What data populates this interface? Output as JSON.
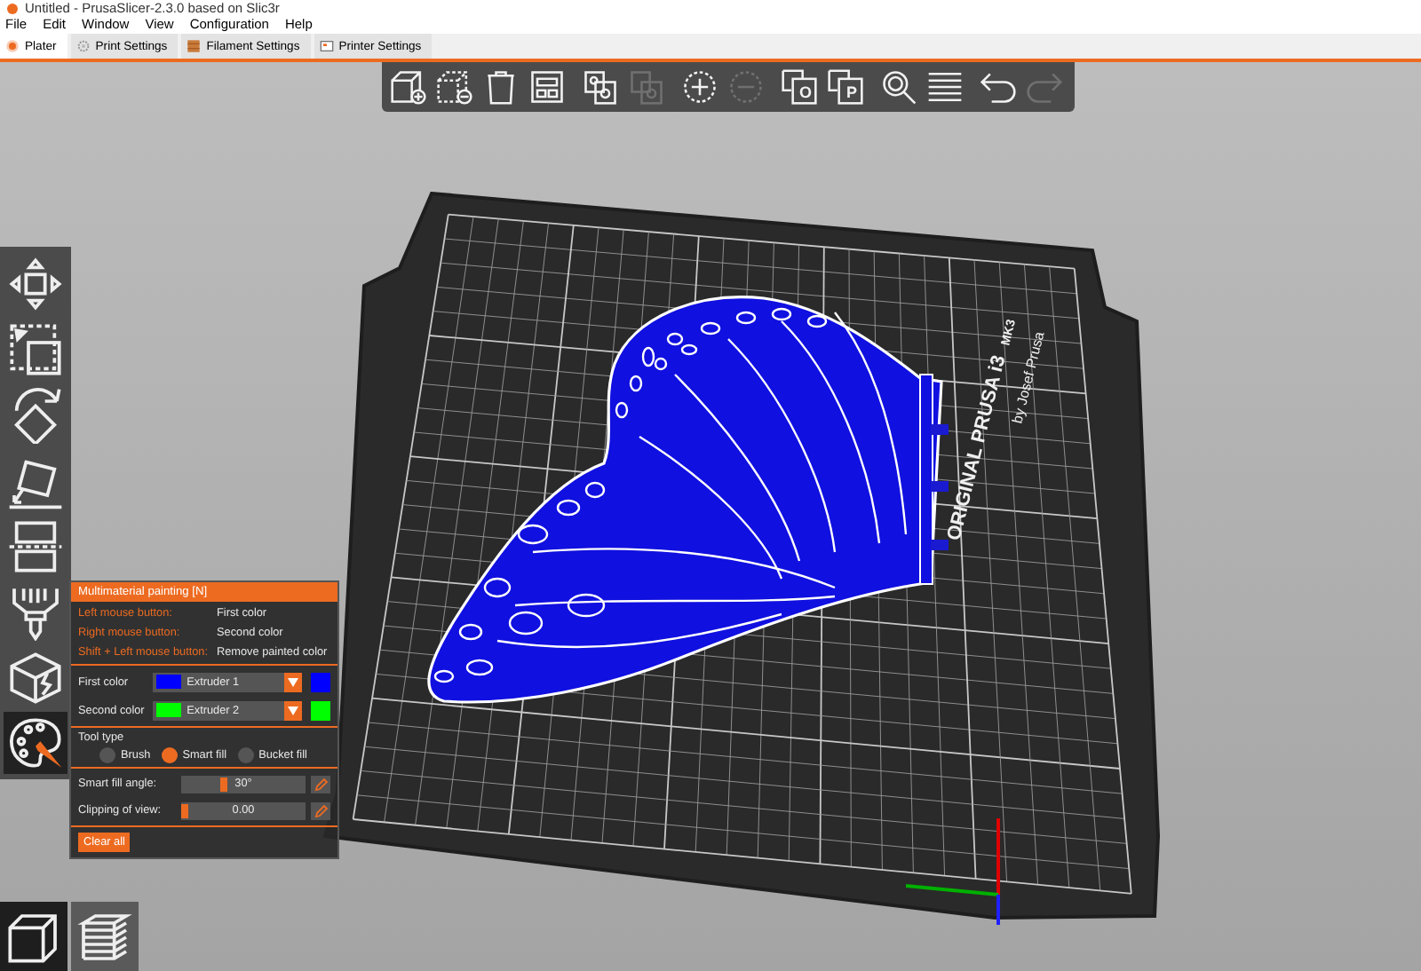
{
  "window": {
    "title": "Untitled - PrusaSlicer-2.3.0 based on Slic3r"
  },
  "menu": [
    "File",
    "Edit",
    "Window",
    "View",
    "Configuration",
    "Help"
  ],
  "tabs": [
    {
      "label": "Plater",
      "kind": "plater",
      "selected": true
    },
    {
      "label": "Print Settings",
      "kind": "print",
      "selected": false
    },
    {
      "label": "Filament Settings",
      "kind": "filament",
      "selected": false
    },
    {
      "label": "Printer Settings",
      "kind": "printer",
      "selected": false
    }
  ],
  "toolbar": [
    {
      "kind": "add",
      "disabled": false
    },
    {
      "kind": "delete",
      "disabled": false
    },
    {
      "kind": "delete_all",
      "disabled": false
    },
    {
      "kind": "arrange",
      "disabled": false
    },
    {
      "kind": "copy",
      "disabled": false
    },
    {
      "kind": "paste",
      "disabled": true
    },
    {
      "kind": "add_instance",
      "disabled": false
    },
    {
      "kind": "remove_instance",
      "disabled": true
    },
    {
      "kind": "split",
      "letter": "O",
      "disabled": false
    },
    {
      "kind": "split",
      "letter": "P",
      "disabled": false
    },
    {
      "kind": "search",
      "disabled": false
    },
    {
      "kind": "layers",
      "disabled": false
    },
    {
      "kind": "undo",
      "disabled": false
    },
    {
      "kind": "redo",
      "disabled": true
    }
  ],
  "gizmos": [
    {
      "kind": "move",
      "selected": false
    },
    {
      "kind": "scale",
      "selected": false
    },
    {
      "kind": "rotate",
      "selected": false
    },
    {
      "kind": "place",
      "selected": false
    },
    {
      "kind": "cut",
      "selected": false
    },
    {
      "kind": "support",
      "selected": false
    },
    {
      "kind": "seam",
      "selected": false
    },
    {
      "kind": "mmu",
      "selected": true
    }
  ],
  "bed_labels": [
    {
      "kind": "brand",
      "text": "ORIGINAL PRUSA i3"
    },
    {
      "kind": "model",
      "text": "MK3"
    },
    {
      "kind": "author",
      "text": "by Josef Prusa"
    }
  ],
  "paint_panel": {
    "title": "Multimaterial painting [N]",
    "hints": [
      {
        "action": "Left mouse button:",
        "result": "First color"
      },
      {
        "action": "Right mouse button:",
        "result": "Second color"
      },
      {
        "action": "Shift + Left mouse button:",
        "result": "Remove painted color"
      }
    ],
    "colors": [
      {
        "label": "First color",
        "value": "Extruder 1",
        "color": "#0000ff"
      },
      {
        "label": "Second color",
        "value": "Extruder 2",
        "color": "#00ff00"
      }
    ],
    "tool_type": {
      "label": "Tool type",
      "options": [
        {
          "label": "Brush",
          "selected": false
        },
        {
          "label": "Smart fill",
          "selected": true
        },
        {
          "label": "Bucket fill",
          "selected": false
        }
      ]
    },
    "sliders": [
      {
        "label": "Smart fill angle:",
        "level": 0.33,
        "reading": "30°"
      },
      {
        "label": "Clipping of view:",
        "level": 0,
        "reading": "0.00"
      }
    ],
    "clear_button": "Clear all"
  },
  "view_buttons": [
    {
      "kind": "model",
      "selected": true
    },
    {
      "kind": "preview",
      "selected": false
    }
  ]
}
